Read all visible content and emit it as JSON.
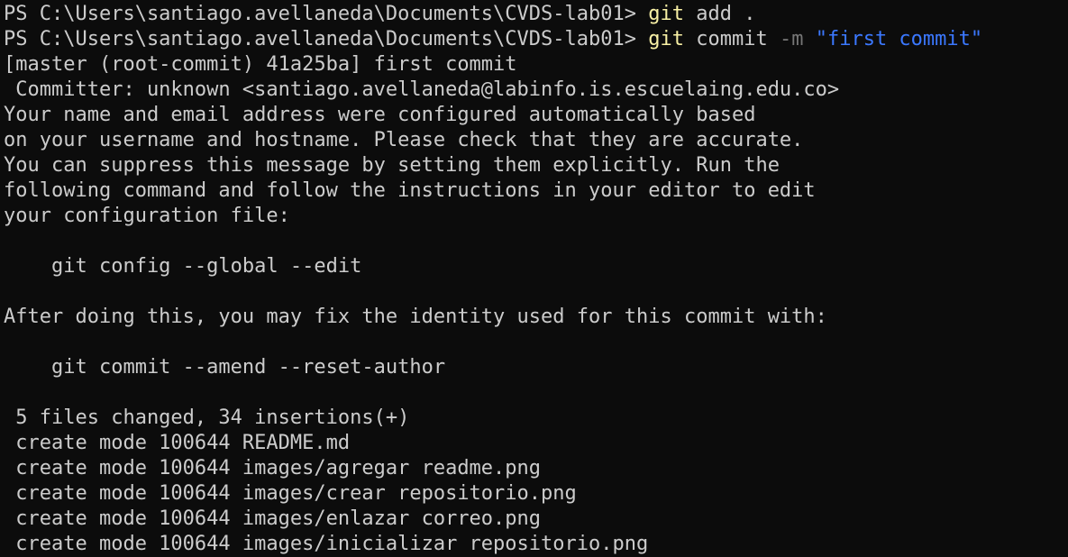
{
  "colors": {
    "background": "#0c0c0c",
    "foreground": "#cccccc",
    "command": "#f9f1a5",
    "parameter": "#767676",
    "string": "#3b78ff"
  },
  "prompt1": {
    "prompt": "PS C:\\Users\\santiago.avellaneda\\Documents\\CVDS-lab01> ",
    "command": "git",
    "args": " add ."
  },
  "prompt2": {
    "prompt": "PS C:\\Users\\santiago.avellaneda\\Documents\\CVDS-lab01> ",
    "command": "git",
    "args": " commit ",
    "flag": "-m",
    "space": " ",
    "message": "\"first commit\""
  },
  "output": [
    "[master (root-commit) 41a25ba] first commit",
    " Committer: unknown <santiago.avellaneda@labinfo.is.escuelaing.edu.co>",
    "Your name and email address were configured automatically based",
    "on your username and hostname. Please check that they are accurate.",
    "You can suppress this message by setting them explicitly. Run the",
    "following command and follow the instructions in your editor to edit",
    "your configuration file:",
    "",
    "    git config --global --edit",
    "",
    "After doing this, you may fix the identity used for this commit with:",
    "",
    "    git commit --amend --reset-author",
    "",
    " 5 files changed, 34 insertions(+)",
    " create mode 100644 README.md",
    " create mode 100644 images/agregar readme.png",
    " create mode 100644 images/crear repositorio.png",
    " create mode 100644 images/enlazar correo.png",
    " create mode 100644 images/inicializar repositorio.png"
  ]
}
